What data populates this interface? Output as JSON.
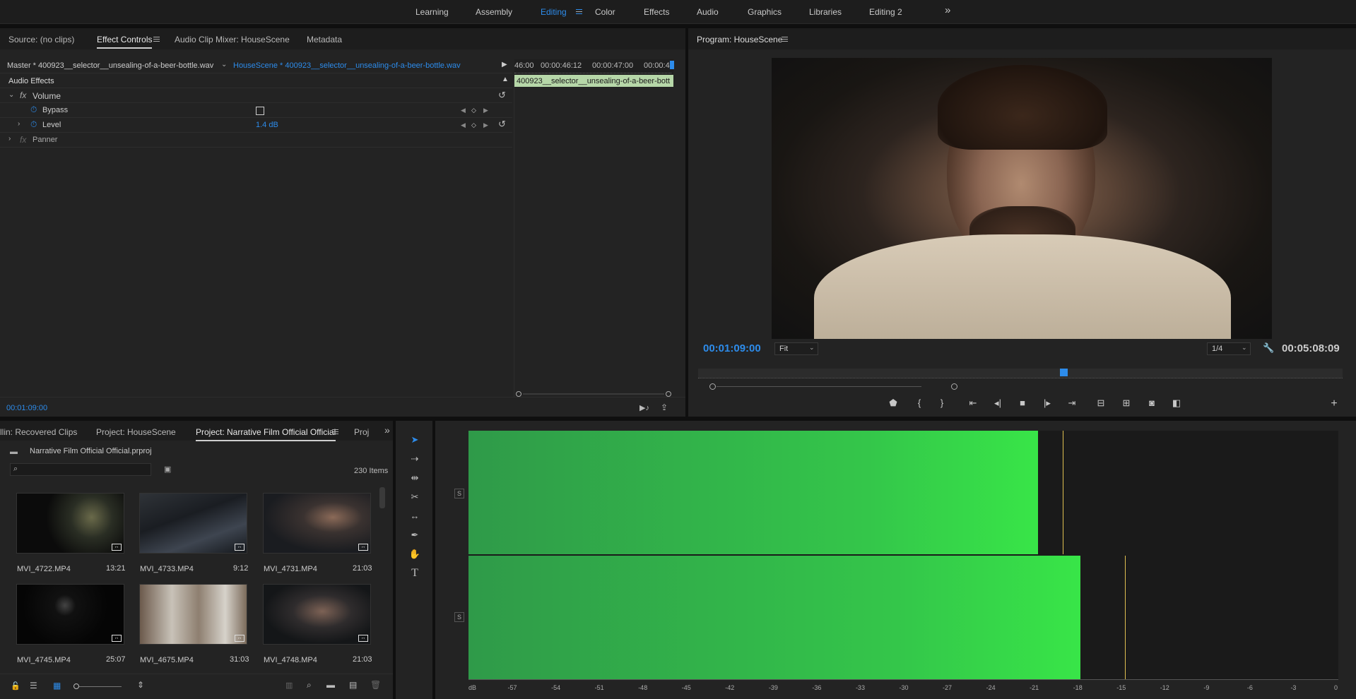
{
  "workspaces": [
    "Learning",
    "Assembly",
    "Editing",
    "Color",
    "Effects",
    "Audio",
    "Graphics",
    "Libraries",
    "Editing 2"
  ],
  "workspace_more": "»",
  "left_tabs": [
    "Source: (no clips)",
    "Effect Controls",
    "Audio Clip Mixer: HouseScene",
    "Metadata"
  ],
  "effect_controls": {
    "master": "Master * 400923__selector__unsealing-of-a-beer-bottle.wav",
    "clip": "HouseScene * 400923__selector__unsealing-of-a-beer-bottle.wav",
    "timecodes": [
      "46:00",
      "00:00:46:12",
      "00:00:47:00",
      "00:00:4"
    ],
    "clip_bar": "400923__selector__unsealing-of-a-beer-bott",
    "section": "Audio Effects",
    "fx1": "Volume",
    "bypass": "Bypass",
    "level": "Level",
    "level_value": "1.4 dB",
    "fx2": "Panner",
    "fx_symbol": "fx",
    "current_time": "00:01:09:00"
  },
  "program": {
    "title": "Program: HouseScene",
    "timecode": "00:01:09:00",
    "fit": "Fit",
    "resolution": "1/4",
    "duration": "00:05:08:09"
  },
  "project": {
    "tabs": [
      "llin: Recovered Clips",
      "Project: HouseScene",
      "Project: Narrative Film Official Official",
      "Proj"
    ],
    "more": "»",
    "file": "Narrative Film Official Official.prproj",
    "items": "230 Items",
    "clips": [
      {
        "name": "MVI_4722.MP4",
        "dur": "13:21"
      },
      {
        "name": "MVI_4733.MP4",
        "dur": "9:12"
      },
      {
        "name": "MVI_4731.MP4",
        "dur": "21:03"
      },
      {
        "name": "MVI_4745.MP4",
        "dur": "25:07"
      },
      {
        "name": "MVI_4675.MP4",
        "dur": "31:03"
      },
      {
        "name": "MVI_4748.MP4",
        "dur": "21:03"
      }
    ]
  },
  "meter": {
    "solo": "S",
    "db_labels": [
      "dB",
      "-57",
      "-54",
      "-51",
      "-48",
      "-45",
      "-42",
      "-39",
      "-36",
      "-33",
      "-30",
      "-27",
      "-24",
      "-21",
      "-18",
      "-15",
      "-12",
      "-9",
      "-6",
      "-3",
      "0"
    ],
    "level_db": [
      -20.7,
      -17.8
    ],
    "peak_db": [
      -19.0,
      -14.7
    ]
  },
  "colors": {
    "accent": "#2d8ceb",
    "meter_green": "#38e548",
    "peak": "#e0c050"
  }
}
